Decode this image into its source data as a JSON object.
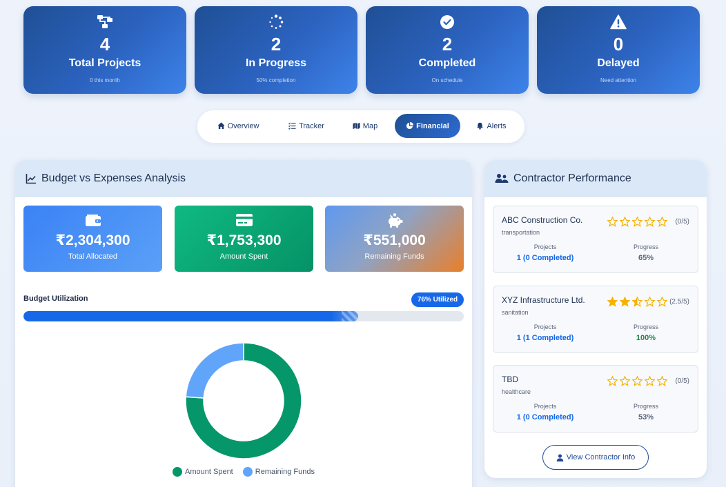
{
  "stats": [
    {
      "icon": "project-diagram-icon",
      "value": "4",
      "label": "Total Projects",
      "sub": "0 this month"
    },
    {
      "icon": "spinner-icon",
      "value": "2",
      "label": "In Progress",
      "sub": "50% completion"
    },
    {
      "icon": "check-circle-icon",
      "value": "2",
      "label": "Completed",
      "sub": "On schedule"
    },
    {
      "icon": "warning-triangle-icon",
      "value": "0",
      "label": "Delayed",
      "sub": "Need attention"
    }
  ],
  "tabs": [
    {
      "label": "Overview",
      "icon": "home-icon",
      "active": false
    },
    {
      "label": "Tracker",
      "icon": "tasks-icon",
      "active": false
    },
    {
      "label": "Map",
      "icon": "map-icon",
      "active": false
    },
    {
      "label": "Financial",
      "icon": "pie-chart-icon",
      "active": true
    },
    {
      "label": "Alerts",
      "icon": "bell-icon",
      "active": false
    }
  ],
  "budget": {
    "title": "Budget vs Expenses Analysis",
    "cards": [
      {
        "icon": "wallet-icon",
        "value": "₹2,304,300",
        "label": "Total Allocated"
      },
      {
        "icon": "credit-card-icon",
        "value": "₹1,753,300",
        "label": "Amount Spent"
      },
      {
        "icon": "piggy-bank-icon",
        "value": "₹551,000",
        "label": "Remaining Funds"
      }
    ],
    "utilization_label": "Budget Utilization",
    "utilization_badge": "76% Utilized",
    "utilization_fraction": 0.76
  },
  "chart_data": {
    "type": "pie",
    "title": "",
    "categories": [
      "Amount Spent",
      "Remaining Funds"
    ],
    "values": [
      1753300,
      551000
    ],
    "colors": [
      "#059669",
      "#60a5fa"
    ],
    "legend": "bottom"
  },
  "contractors": {
    "title": "Contractor Performance",
    "items": [
      {
        "name": "ABC Construction Co.",
        "category": "transportation",
        "rating": 0,
        "rating_text": "(0/5)",
        "projects_label": "Projects",
        "projects_value": "1 (0 Completed)",
        "progress_label": "Progress",
        "progress_value": "65%",
        "progress_status": "gray"
      },
      {
        "name": "XYZ Infrastructure Ltd.",
        "category": "sanitation",
        "rating": 2.5,
        "rating_text": "(2.5/5)",
        "projects_label": "Projects",
        "projects_value": "1 (1 Completed)",
        "progress_label": "Progress",
        "progress_value": "100%",
        "progress_status": "green"
      },
      {
        "name": "TBD",
        "category": "healthcare",
        "rating": 0,
        "rating_text": "(0/5)",
        "projects_label": "Projects",
        "projects_value": "1 (0 Completed)",
        "progress_label": "Progress",
        "progress_value": "53%",
        "progress_status": "gray"
      }
    ],
    "view_button": "View Contractor Info"
  }
}
